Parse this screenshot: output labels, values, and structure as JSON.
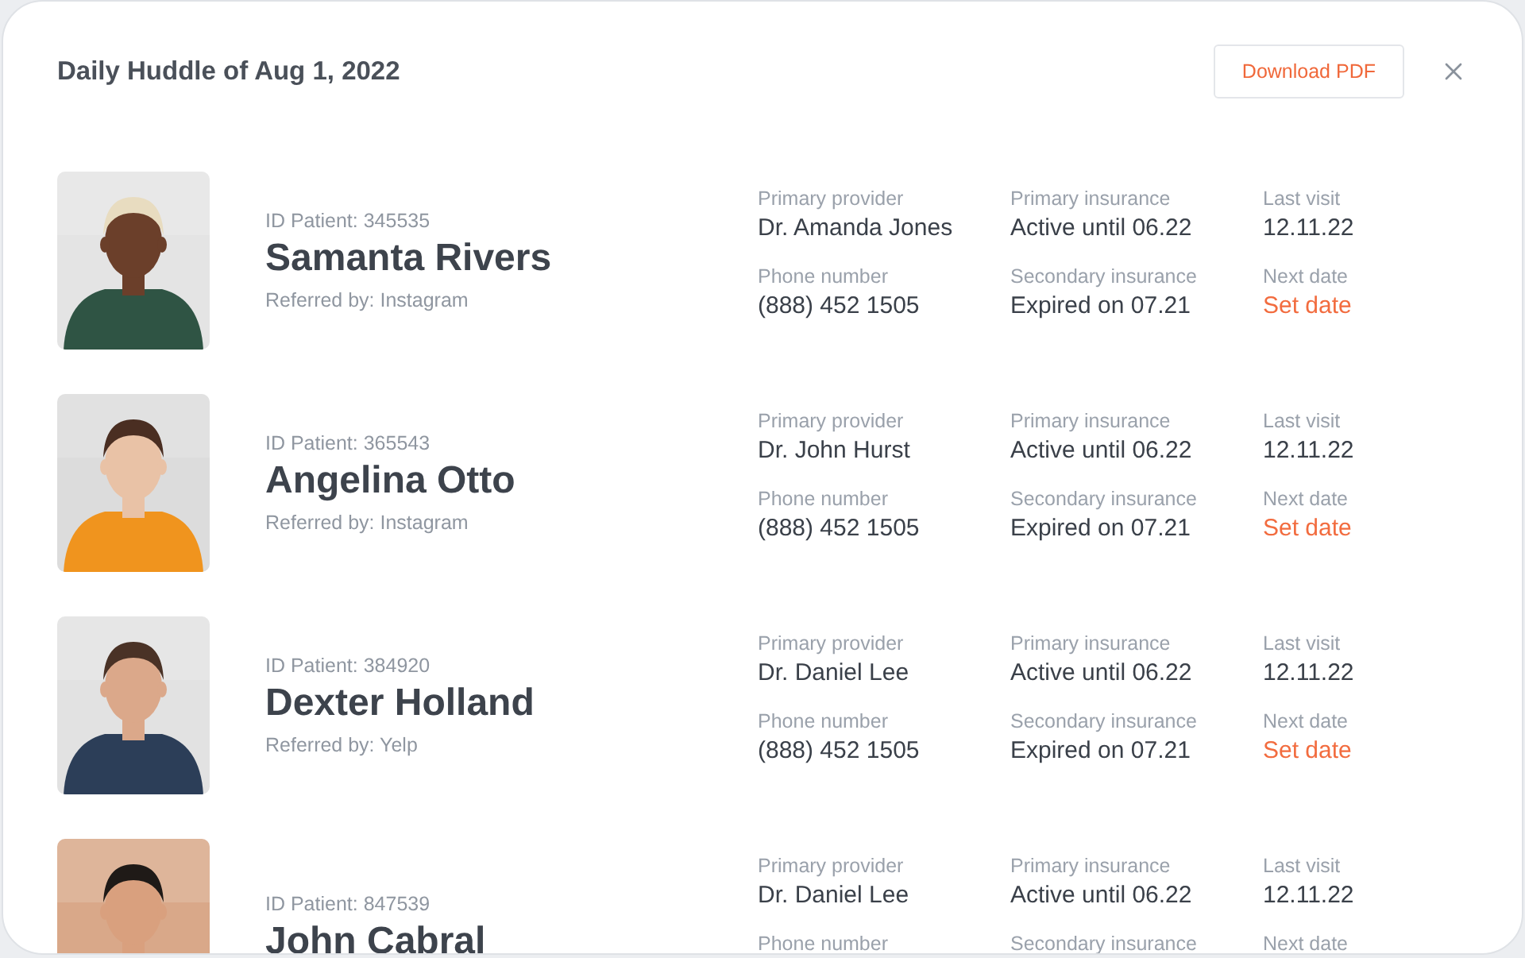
{
  "title": "Daily Huddle of Aug 1, 2022",
  "download_button": "Download PDF",
  "patients": [
    {
      "id_label": "ID Patient: 345535",
      "name": "Samanta Rivers",
      "referred": "Referred by: Instagram",
      "fields": [
        {
          "label": "Primary provider",
          "value": "Dr. Amanda Jones",
          "kind": "text"
        },
        {
          "label": "Primary insurance",
          "value": "Active until 06.22",
          "kind": "text"
        },
        {
          "label": "Last visit",
          "value": "12.11.22",
          "kind": "text"
        },
        {
          "label": "Phone number",
          "value": "(888) 452 1505",
          "kind": "text"
        },
        {
          "label": "Secondary insurance",
          "value": "Expired on 07.21",
          "kind": "text"
        },
        {
          "label": "Next date",
          "value": "Set date",
          "kind": "link"
        }
      ]
    },
    {
      "id_label": "ID Patient: 365543",
      "name": "Angelina Otto",
      "referred": "Referred by: Instagram",
      "fields": [
        {
          "label": "Primary provider",
          "value": "Dr. John Hurst",
          "kind": "text"
        },
        {
          "label": "Primary insurance",
          "value": "Active until 06.22",
          "kind": "text"
        },
        {
          "label": "Last visit",
          "value": "12.11.22",
          "kind": "text"
        },
        {
          "label": "Phone number",
          "value": "(888) 452 1505",
          "kind": "text"
        },
        {
          "label": "Secondary insurance",
          "value": "Expired on 07.21",
          "kind": "text"
        },
        {
          "label": "Next date",
          "value": "Set date",
          "kind": "link"
        }
      ]
    },
    {
      "id_label": "ID Patient: 384920",
      "name": "Dexter Holland",
      "referred": "Referred by: Yelp",
      "fields": [
        {
          "label": "Primary provider",
          "value": "Dr. Daniel Lee",
          "kind": "text"
        },
        {
          "label": "Primary insurance",
          "value": "Active until 06.22",
          "kind": "text"
        },
        {
          "label": "Last visit",
          "value": "12.11.22",
          "kind": "text"
        },
        {
          "label": "Phone number",
          "value": "(888) 452 1505",
          "kind": "text"
        },
        {
          "label": "Secondary insurance",
          "value": "Expired on 07.21",
          "kind": "text"
        },
        {
          "label": "Next date",
          "value": "Set date",
          "kind": "link"
        }
      ]
    },
    {
      "id_label": "ID Patient: 847539",
      "name": "John Cabral",
      "fields": [
        {
          "label": "Primary provider",
          "value": "Dr. Daniel Lee",
          "kind": "text"
        },
        {
          "label": "Primary insurance",
          "value": "Active until 06.22",
          "kind": "text"
        },
        {
          "label": "Last visit",
          "value": "12.11.22",
          "kind": "text"
        },
        {
          "label": "Phone number"
        },
        {
          "label": "Secondary insurance"
        },
        {
          "label": "Next date"
        }
      ]
    }
  ]
}
